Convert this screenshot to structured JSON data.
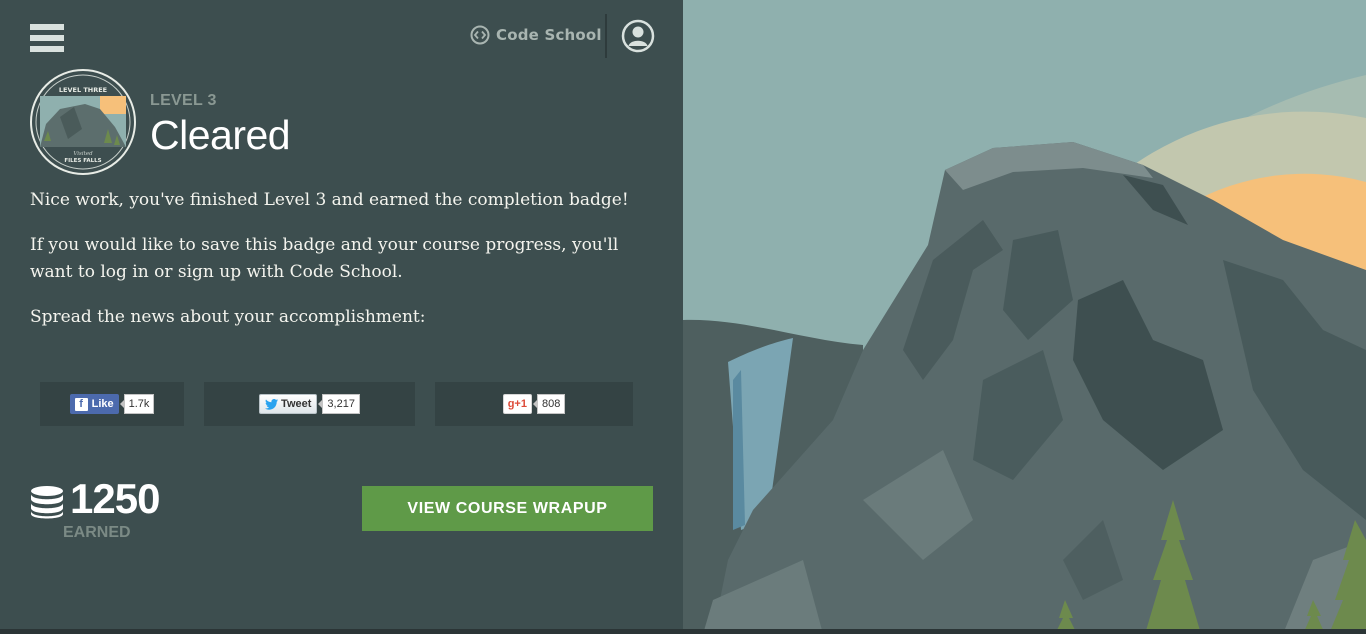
{
  "header": {
    "brand": "Code School",
    "icons": {
      "menu": "hamburger-menu-icon",
      "brand": "code-brackets-icon",
      "account": "user-account-icon"
    }
  },
  "badge": {
    "top_text": "LEVEL THREE",
    "script_text": "Visited",
    "bottom_text": "FILES FALLS"
  },
  "level": {
    "label": "LEVEL 3",
    "title": "Cleared"
  },
  "message": {
    "p1": "Nice work, you've finished Level 3 and earned the completion badge!",
    "p2": "If you would like to save this badge and your course progress, you'll want to log in or sign up with Code School.",
    "p3": "Spread the news about your accomplishment:"
  },
  "share": {
    "facebook": {
      "label": "Like",
      "count": "1.7k"
    },
    "twitter": {
      "label": "Tweet",
      "count": "3,217"
    },
    "google": {
      "label": "g+1",
      "count": "808"
    }
  },
  "points": {
    "value": "1250",
    "caption": "EARNED"
  },
  "cta": {
    "label": "VIEW COURSE WRAPUP"
  },
  "colors": {
    "panel_bg": "#3d4e4f",
    "cta_green": "#5f9a48",
    "sky": "#8fb0ae",
    "sun": "#f6c07a"
  }
}
